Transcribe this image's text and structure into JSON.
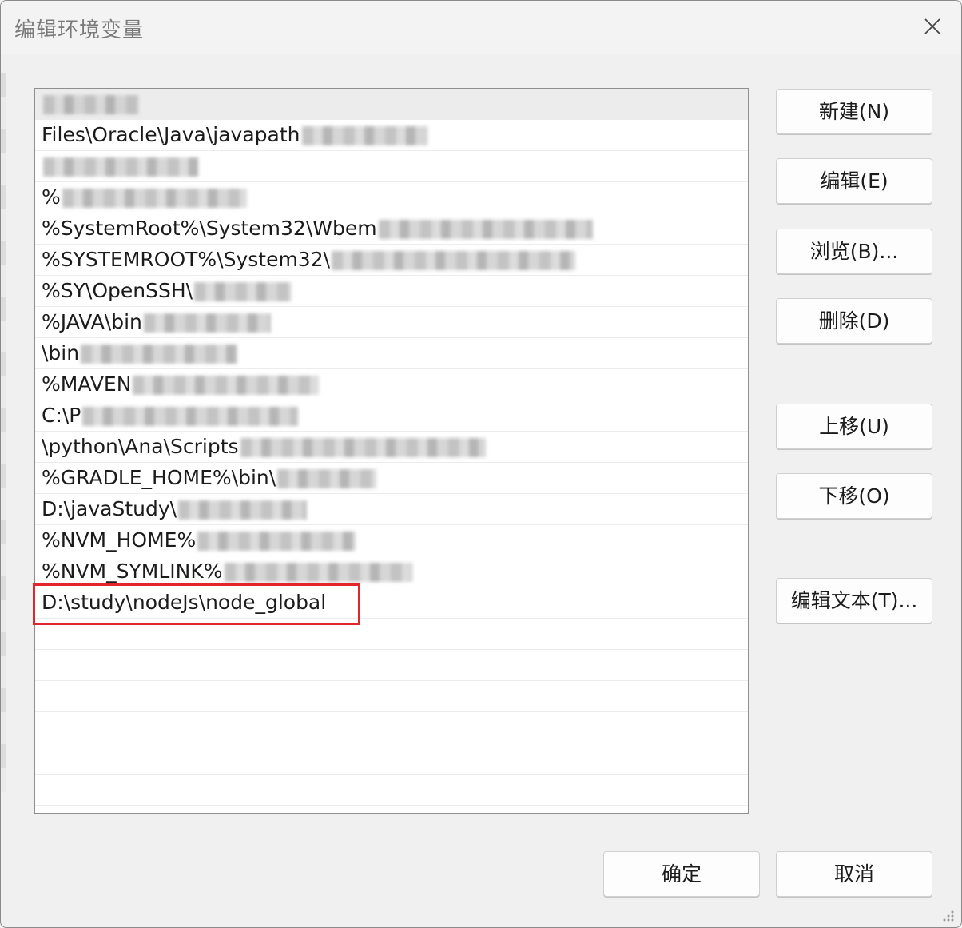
{
  "window": {
    "title": "编辑环境变量",
    "close_icon": "close-icon"
  },
  "list": {
    "items": [
      {
        "text": "",
        "blurred": true
      },
      {
        "text": "Files\\Oracle\\Java\\javapath",
        "blurred": true
      },
      {
        "text": "",
        "blurred": true
      },
      {
        "text": "%",
        "blurred": true
      },
      {
        "text": "%SystemRoot%\\System32\\Wbem",
        "blurred": true
      },
      {
        "text": "%SYSTEMROOT%\\System32\\",
        "blurred": true
      },
      {
        "text": "%SY\\OpenSSH\\",
        "blurred": true
      },
      {
        "text": "%JAVA\\bin",
        "blurred": true
      },
      {
        "text": "\\bin",
        "blurred": true
      },
      {
        "text": "%MAVEN",
        "blurred": true
      },
      {
        "text": "C:\\P",
        "blurred": true
      },
      {
        "text": "\\python\\Ana\\Scripts",
        "blurred": true
      },
      {
        "text": "%GRADLE_HOME%\\bin\\",
        "blurred": true
      },
      {
        "text": "D:\\javaStudy\\",
        "blurred": true
      },
      {
        "text": "%NVM_HOME%",
        "blurred": true
      },
      {
        "text": "%NVM_SYMLINK%",
        "blurred": true
      },
      {
        "text": "D:\\study\\nodeJs\\node_global",
        "blurred": false
      },
      {
        "text": "",
        "blurred": false
      },
      {
        "text": "",
        "blurred": false
      },
      {
        "text": "",
        "blurred": false
      },
      {
        "text": "",
        "blurred": false
      },
      {
        "text": "",
        "blurred": false
      },
      {
        "text": "",
        "blurred": false
      }
    ]
  },
  "buttons": {
    "new": "新建(N)",
    "edit": "编辑(E)",
    "browse": "浏览(B)...",
    "delete": "删除(D)",
    "move_up": "上移(U)",
    "move_down": "下移(O)",
    "edit_text": "编辑文本(T)...",
    "ok": "确定",
    "cancel": "取消"
  },
  "colors": {
    "highlight_border": "#e2242b"
  }
}
